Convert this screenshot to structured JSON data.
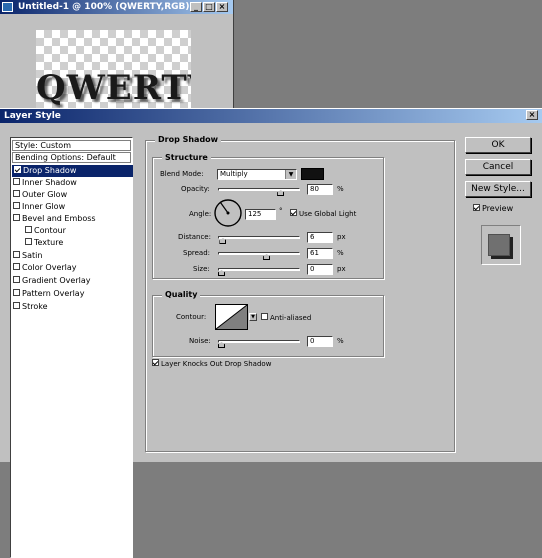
{
  "document_window": {
    "title": "Untitled-1 @ 100% (QWERTY,RGB)",
    "canvas_text": "QWERTY",
    "buttons": {
      "minimize": "_",
      "maximize": "□",
      "close": "×"
    }
  },
  "dialog": {
    "title": "Layer Style",
    "close_label": "×",
    "style_list": [
      {
        "label": "Style: Custom",
        "kind": "header"
      },
      {
        "label": "Bending Options: Default",
        "kind": "header"
      },
      {
        "label": "Drop Shadow",
        "kind": "checkbox",
        "checked": true,
        "selected": true
      },
      {
        "label": "Inner Shadow",
        "kind": "checkbox",
        "checked": false
      },
      {
        "label": "Outer Glow",
        "kind": "checkbox",
        "checked": false
      },
      {
        "label": "Inner Glow",
        "kind": "checkbox",
        "checked": false
      },
      {
        "label": "Bevel and Emboss",
        "kind": "checkbox",
        "checked": false
      },
      {
        "label": "Contour",
        "kind": "sub",
        "checked": false
      },
      {
        "label": "Texture",
        "kind": "sub",
        "checked": false
      },
      {
        "label": "Satin",
        "kind": "checkbox",
        "checked": false
      },
      {
        "label": "Color Overlay",
        "kind": "checkbox",
        "checked": false
      },
      {
        "label": "Gradient Overlay",
        "kind": "checkbox",
        "checked": false
      },
      {
        "label": "Pattern Overlay",
        "kind": "checkbox",
        "checked": false
      },
      {
        "label": "Stroke",
        "kind": "checkbox",
        "checked": false
      }
    ],
    "drop_shadow": {
      "section_title": "Drop Shadow",
      "structure_title": "Structure",
      "blend_mode_label": "Blend Mode:",
      "blend_mode_value": "Multiply",
      "shadow_color": "#111111",
      "opacity_label": "Opacity:",
      "opacity_value": "80",
      "opacity_unit": "%",
      "opacity_fraction": 0.8,
      "angle_label": "Angle:",
      "angle_value": "125",
      "angle_unit": "°",
      "use_global_light_label": "Use Global Light",
      "use_global_light_checked": true,
      "distance_label": "Distance:",
      "distance_value": "6",
      "distance_unit": "px",
      "distance_fraction": 0.02,
      "spread_label": "Spread:",
      "spread_value": "61",
      "spread_unit": "%",
      "spread_fraction": 0.61,
      "size_label": "Size:",
      "size_value": "0",
      "size_unit": "px",
      "size_fraction": 0.0,
      "quality_title": "Quality",
      "contour_label": "Contour:",
      "anti_aliased_label": "Anti-aliased",
      "anti_aliased_checked": false,
      "noise_label": "Noise:",
      "noise_value": "0",
      "noise_unit": "%",
      "noise_fraction": 0.0,
      "knockout_label": "Layer Knocks Out Drop Shadow",
      "knockout_checked": true
    },
    "buttons": {
      "ok": "OK",
      "cancel": "Cancel",
      "new_style": "New Style..."
    },
    "preview_label": "Preview",
    "preview_checked": true
  }
}
